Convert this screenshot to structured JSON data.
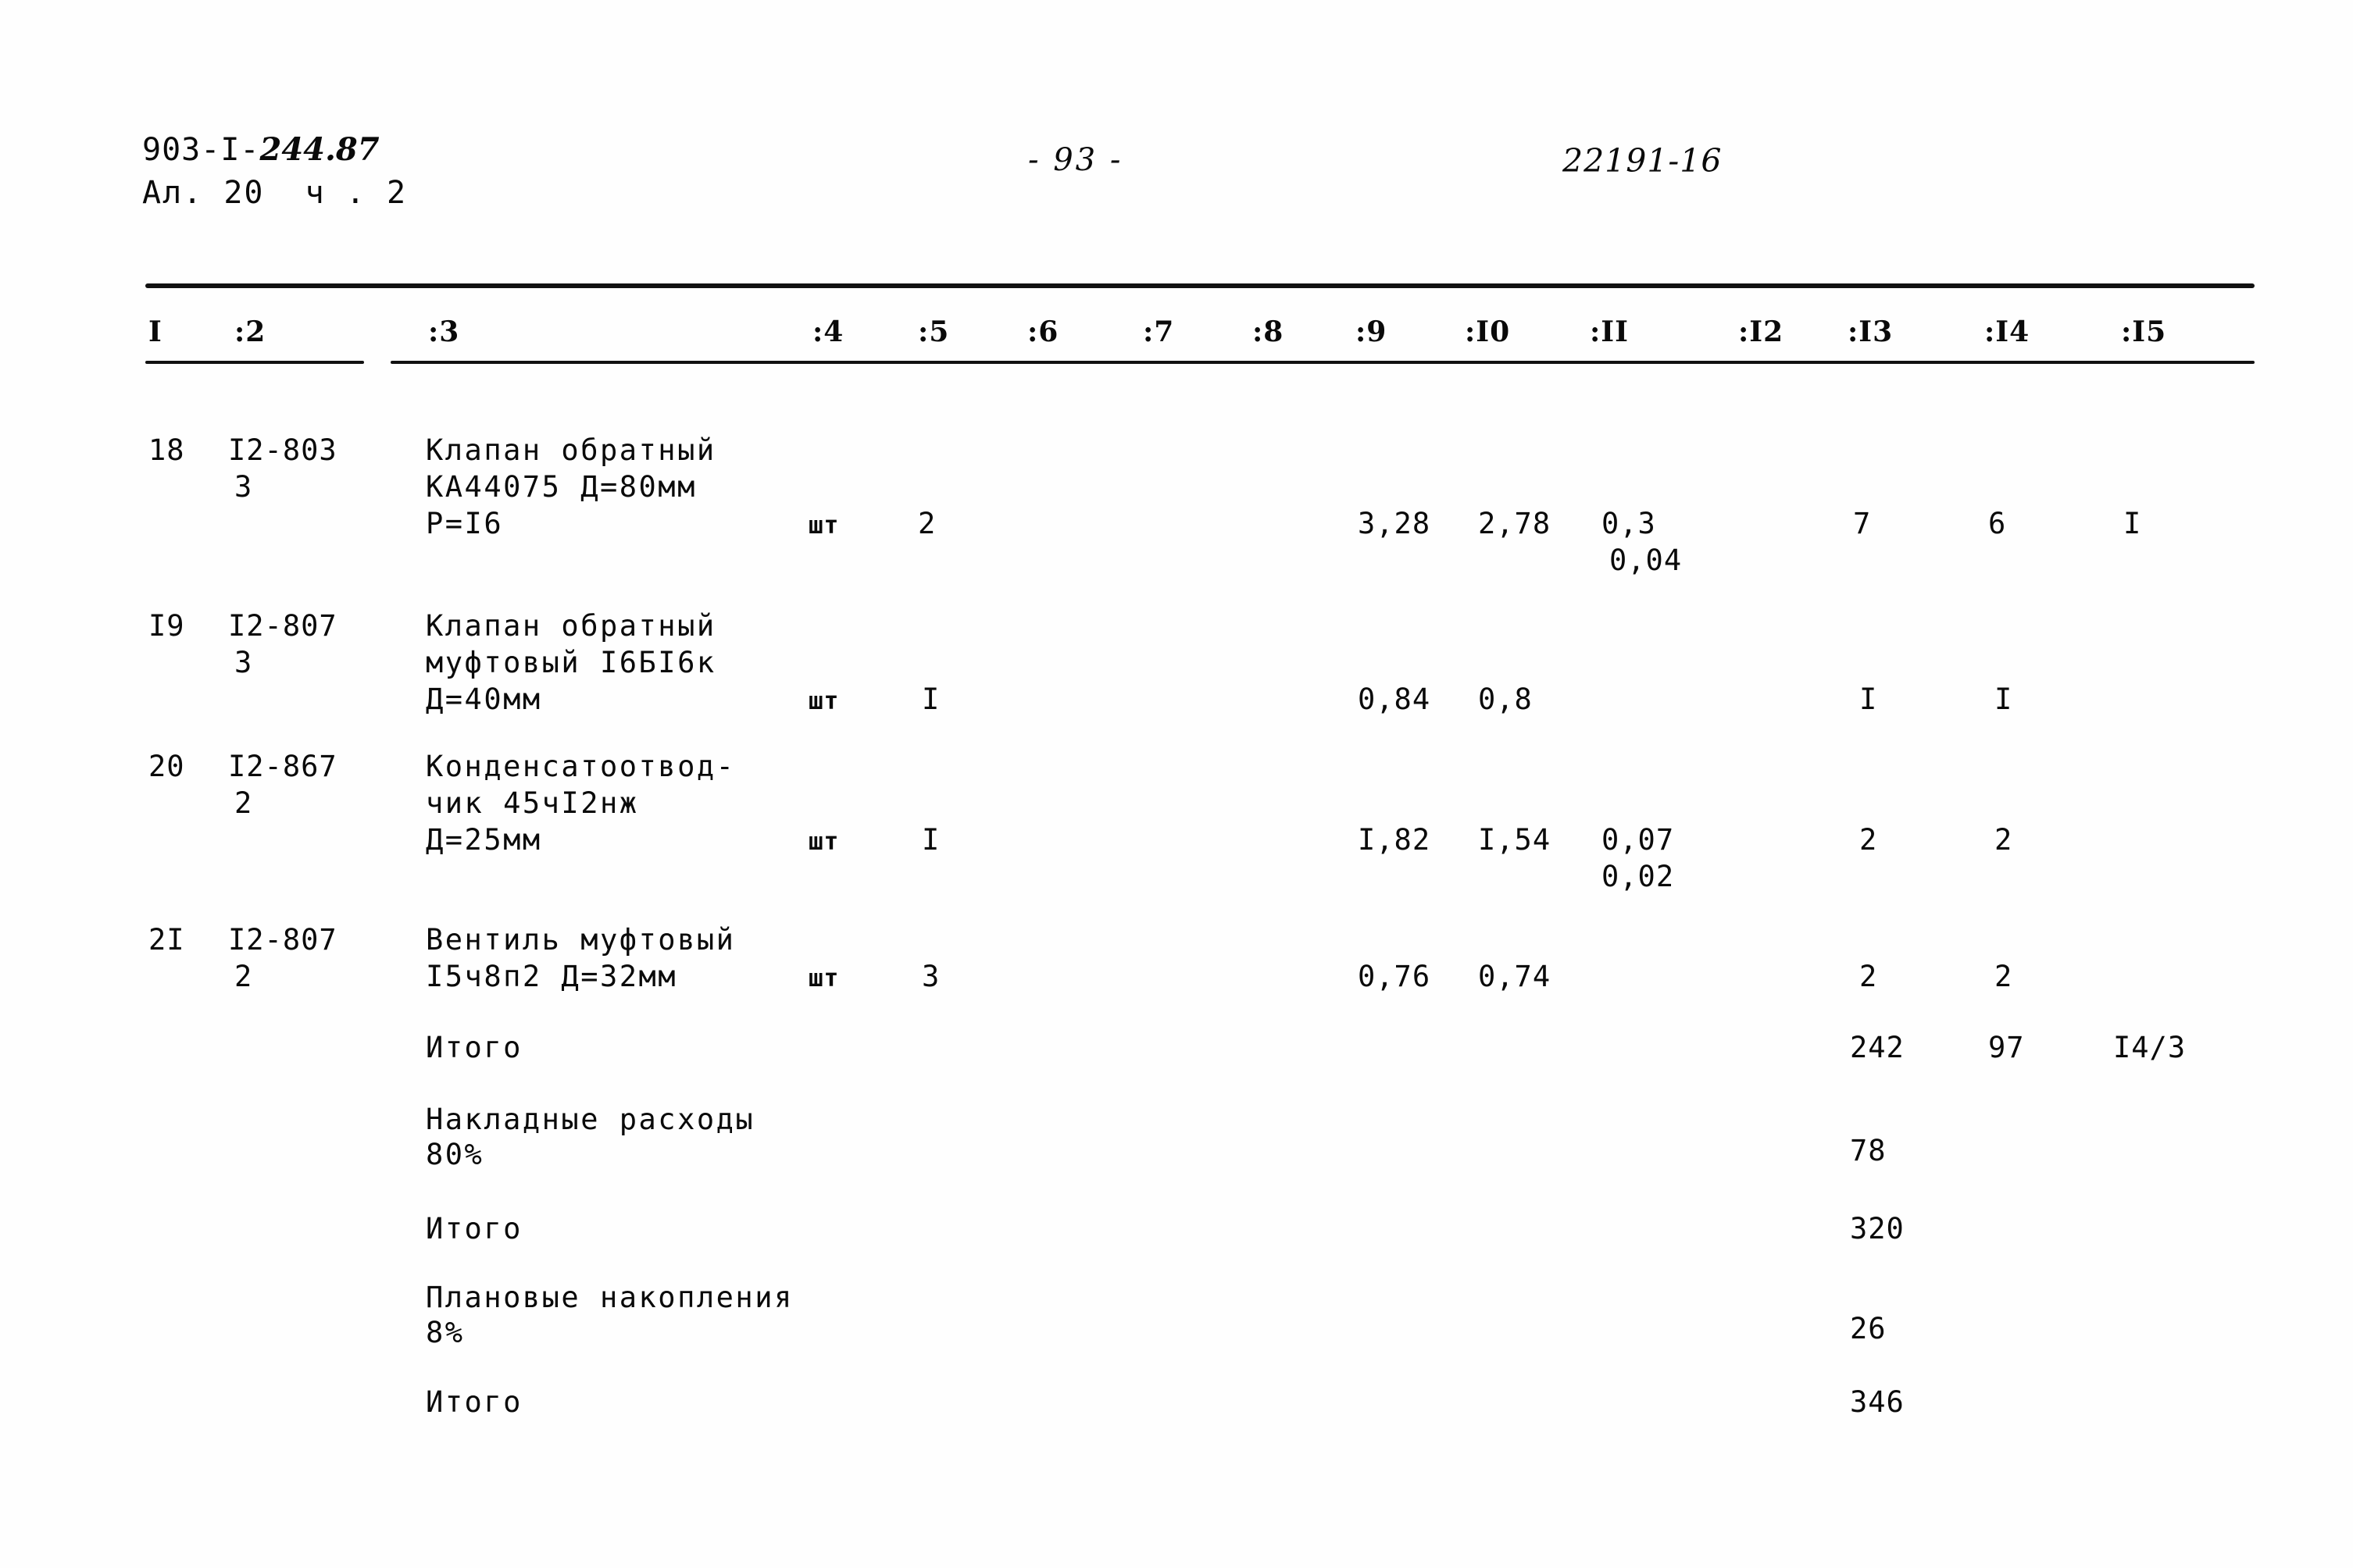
{
  "header": {
    "project_code_prefix": "903-I-",
    "project_code_suffix": "244.87",
    "album_line": "Ал. 20  ч . 2",
    "page_number": "- 93 -",
    "sheet_id": "22191-16"
  },
  "table": {
    "column_headers": [
      "I",
      ":2",
      ":3",
      ":4",
      ":5",
      ":6",
      ":7",
      ":8",
      ":9",
      ":I0",
      ":II",
      ":I2",
      ":I3",
      ":I4",
      ":I5"
    ],
    "rows": [
      {
        "no": "18",
        "code": "I2-803",
        "code2": "3",
        "desc": [
          "Клапан обратный",
          "КА44075 Д=80мм",
          "Р=I6"
        ],
        "unit": "шт",
        "c5": "2",
        "c9": "3,28",
        "c10": "2,78",
        "c11": "0,3",
        "c11b": "0,04",
        "c13": "7",
        "c14": "6",
        "c15": "I"
      },
      {
        "no": "I9",
        "code": "I2-807",
        "code2": "3",
        "desc": [
          "Клапан обратный",
          "муфтовый I6БI6к",
          "Д=40мм"
        ],
        "unit": "шт",
        "c5": "I",
        "c9": "0,84",
        "c10": "0,8",
        "c11": "",
        "c11b": "",
        "c13": "I",
        "c14": "I",
        "c15": ""
      },
      {
        "no": "20",
        "code": "I2-867",
        "code2": "2",
        "desc": [
          "Конденсатоотвод-",
          "чик 45чI2нж",
          "Д=25мм"
        ],
        "unit": "шт",
        "c5": "I",
        "c9": "I,82",
        "c10": "I,54",
        "c11": "0,07",
        "c11b": "0,02",
        "c13": "2",
        "c14": "2",
        "c15": ""
      },
      {
        "no": "2I",
        "code": "I2-807",
        "code2": "2",
        "desc": [
          "Вентиль муфтовый",
          "I5ч8п2 Д=32мм"
        ],
        "unit": "шт",
        "c5": "3",
        "c9": "0,76",
        "c10": "0,74",
        "c11": "",
        "c11b": "",
        "c13": "2",
        "c14": "2",
        "c15": ""
      }
    ],
    "summary": [
      {
        "label": "Итого",
        "label2": "",
        "c13": "242",
        "c14": "97",
        "c15": "I4/3"
      },
      {
        "label": "Накладные расходы",
        "label2": "80%",
        "c13": "78",
        "c14": "",
        "c15": ""
      },
      {
        "label": "Итого",
        "label2": "",
        "c13": "320",
        "c14": "",
        "c15": ""
      },
      {
        "label": "Плановые накопления",
        "label2": "8%",
        "c13": "26",
        "c14": "",
        "c15": ""
      },
      {
        "label": "Итого",
        "label2": "",
        "c13": "346",
        "c14": "",
        "c15": ""
      }
    ]
  }
}
